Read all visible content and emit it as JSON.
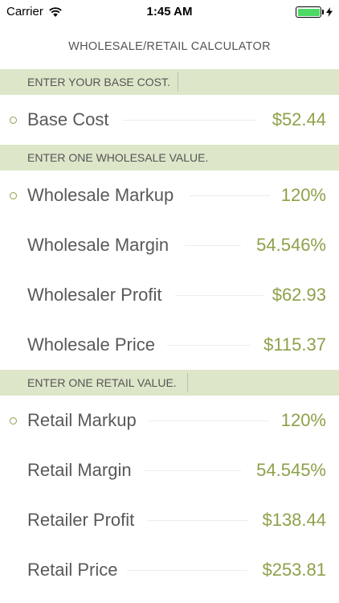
{
  "status_bar": {
    "carrier": "Carrier",
    "time": "1:45 AM",
    "battery_color": "#4cd964"
  },
  "title": "WHOLESALE/RETAIL CALCULATOR",
  "colors": {
    "accent": "#8da14a",
    "header_bg": "#dde6c9",
    "label": "#595959"
  },
  "sections": {
    "base": {
      "header": "ENTER YOUR BASE COST.",
      "rows": [
        {
          "label": "Base Cost",
          "value": "$52.44",
          "selected": true
        }
      ]
    },
    "wholesale": {
      "header": "ENTER ONE WHOLESALE VALUE.",
      "rows": [
        {
          "label": "Wholesale Markup",
          "value": "120%",
          "selected": true
        },
        {
          "label": "Wholesale Margin",
          "value": "54.546%",
          "selected": false
        },
        {
          "label": "Wholesaler Profit",
          "value": "$62.93",
          "selected": false
        },
        {
          "label": "Wholesale Price",
          "value": "$115.37",
          "selected": false
        }
      ]
    },
    "retail": {
      "header": "ENTER ONE RETAIL VALUE.",
      "rows": [
        {
          "label": "Retail Markup",
          "value": "120%",
          "selected": true
        },
        {
          "label": "Retail Margin",
          "value": "54.545%",
          "selected": false
        },
        {
          "label": "Retailer Profit",
          "value": "$138.44",
          "selected": false
        },
        {
          "label": "Retail Price",
          "value": "$253.81",
          "selected": false
        }
      ]
    }
  }
}
